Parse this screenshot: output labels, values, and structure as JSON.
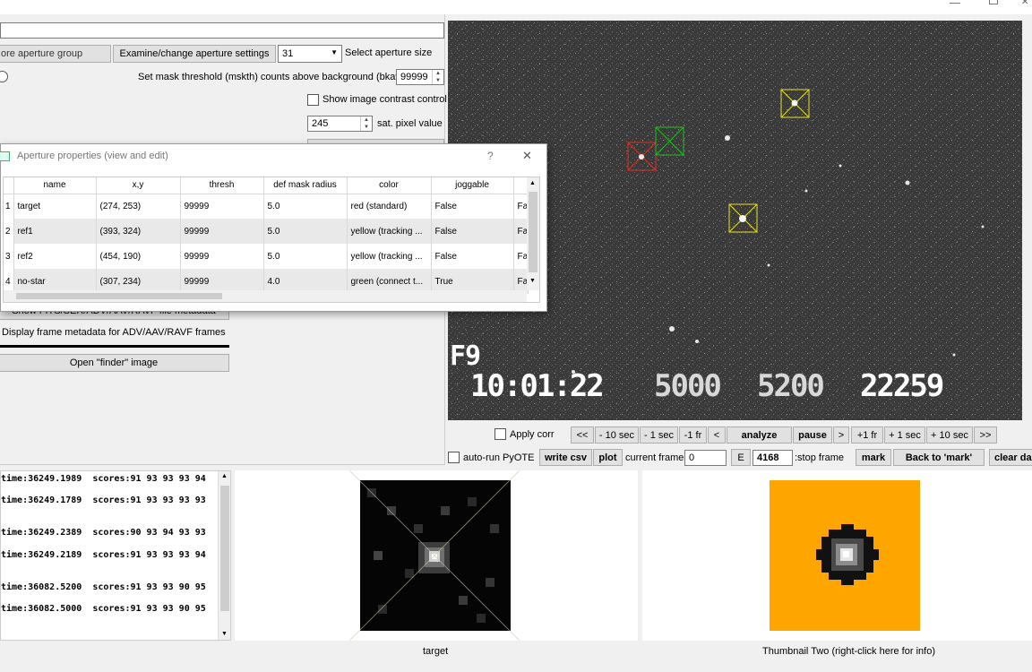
{
  "top_field": {
    "value": ""
  },
  "aperture": {
    "store_group_label": "ore aperture group",
    "examine_label": "Examine/change aperture settings",
    "size_value": "31",
    "size_label": "Select aperture size",
    "mask_label": "Set mask threshold (mskth) counts above background (bkavg)",
    "mask_value": "99999",
    "contrast_label": "Show image contrast control",
    "sat_value": "245",
    "sat_label": "sat. pixel value"
  },
  "dialog": {
    "title": "Aperture properties (view and edit)",
    "help": "?",
    "close": "✕",
    "columns": [
      "name",
      "x,y",
      "thresh",
      "def mask radius",
      "color",
      "joggable",
      ""
    ],
    "rows": [
      {
        "num": "1",
        "name": "target",
        "xy": "(274, 253)",
        "thresh": "99999",
        "radius": "5.0",
        "color": "red (standard)",
        "jog": "False",
        "extra": "Fa"
      },
      {
        "num": "2",
        "name": "ref1",
        "xy": "(393, 324)",
        "thresh": "99999",
        "radius": "5.0",
        "color": "yellow (tracking ...",
        "jog": "False",
        "extra": "Fa"
      },
      {
        "num": "3",
        "name": "ref2",
        "xy": "(454, 190)",
        "thresh": "99999",
        "radius": "5.0",
        "color": "yellow (tracking ...",
        "jog": "False",
        "extra": "Fa"
      },
      {
        "num": "4",
        "name": "no-star",
        "xy": "(307, 234)",
        "thresh": "99999",
        "radius": "4.0",
        "color": "green (connect t...",
        "jog": "True",
        "extra": "Fa"
      }
    ]
  },
  "left_panel": {
    "fits_btn": "Show FITS/SER/ADV/AAV/RAVF file metadata",
    "frame_meta_label": "Display frame metadata for ADV/AAV/RAVF frames",
    "finder_btn": "Open \"finder\" image"
  },
  "video": {
    "overlay_f": "F9",
    "overlay_time": "10:01:22",
    "overlay_n1": "5000",
    "overlay_n2": "5200",
    "overlay_n3": "22259"
  },
  "controls": {
    "apply_corr": "Apply corr",
    "first": "<<",
    "minus10": "- 10 sec",
    "minus1s": "- 1 sec",
    "minus1f": "-1 fr",
    "prev": "<",
    "analyze": "analyze",
    "pause": "pause",
    "next": ">",
    "plus1f": "+1 fr",
    "plus1s": "+ 1 sec",
    "plus10": "+ 10 sec",
    "last": ">>",
    "autorun": "auto-run PyOTE",
    "write_csv": "write csv",
    "plot": "plot",
    "current_frame_label": "current frame:",
    "current_frame": "0",
    "e_btn": "E",
    "stop_frame": "4168",
    "stop_frame_label": ":stop frame",
    "mark": "mark",
    "back_to_mark": "Back to 'mark'",
    "clear": "clear da"
  },
  "log_lines": [
    "time:36249.1989  scores:91 93 93 93 94",
    "time:36249.1789  scores:91 93 93 93 93",
    "time:36249.2389  scores:90 93 94 93 93",
    "time:36249.2189  scores:91 93 93 93 94",
    "time:36082.5200  scores:91 93 93 90 95",
    "time:36082.5000  scores:91 93 93 90 95"
  ],
  "thumbnails": {
    "one_label": "target",
    "two_label": "Thumbnail Two (right-click here for info)"
  },
  "colors": {
    "video_bg": "#3a3a3a",
    "thumb_two_bg": "#ffa500",
    "aperture_red": "#e03020",
    "aperture_green": "#20c020",
    "aperture_yellow": "#e8e020"
  }
}
